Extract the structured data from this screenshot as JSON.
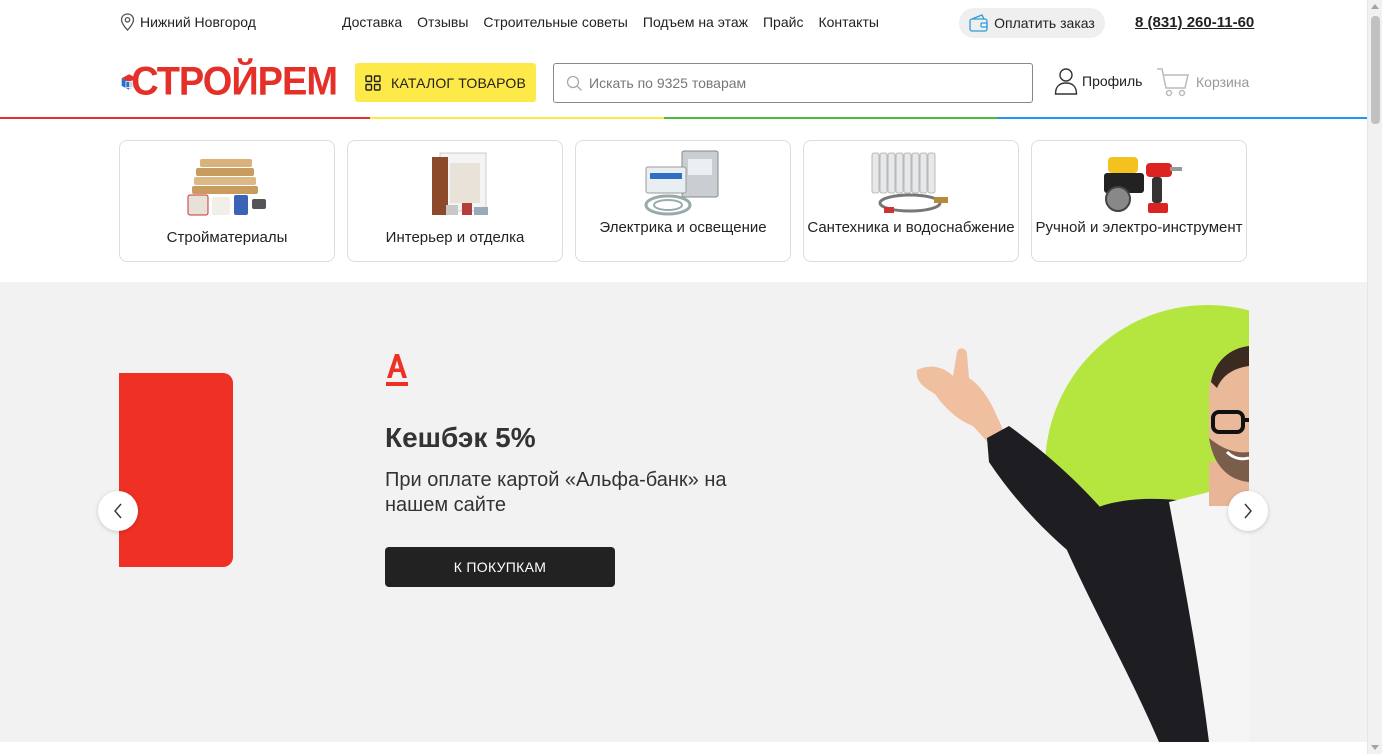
{
  "topbar": {
    "city": "Нижний Новгород",
    "nav": [
      "Доставка",
      "Отзывы",
      "Строительные советы",
      "Подъем на этаж",
      "Прайс",
      "Контакты"
    ],
    "pay_label": "Оплатить заказ",
    "phone": "8 (831) 260-11-60"
  },
  "header": {
    "logo_text": "СТРОЙРЕМ",
    "catalog_label": "КАТАЛОГ ТОВАРОВ",
    "search_placeholder": "Искать по 9325 товарам",
    "profile_label": "Профиль",
    "cart_label": "Корзина"
  },
  "color_line": [
    "#e5302a",
    "#fde947",
    "#4cba3b",
    "#2196f3"
  ],
  "categories": [
    {
      "label": "Стройматериалы",
      "icon": "lumber-icon"
    },
    {
      "label": "Интерьер и отделка",
      "icon": "door-icon"
    },
    {
      "label": "Электрика и освещение",
      "icon": "electrical-panel-icon"
    },
    {
      "label": "Сантехника и водоснабжение",
      "icon": "radiator-icon"
    },
    {
      "label": "Ручной и электро-инструмент",
      "icon": "power-tools-icon"
    }
  ],
  "hero": {
    "bank_logo": "А",
    "title": "Кешбэк 5%",
    "subtitle": "При оплате картой «Альфа-банк» на нашем сайте",
    "button_label": "К ПОКУПКАМ",
    "colors": {
      "card": "#ee3124",
      "circle": "#b5e63f",
      "button": "#222222"
    }
  }
}
